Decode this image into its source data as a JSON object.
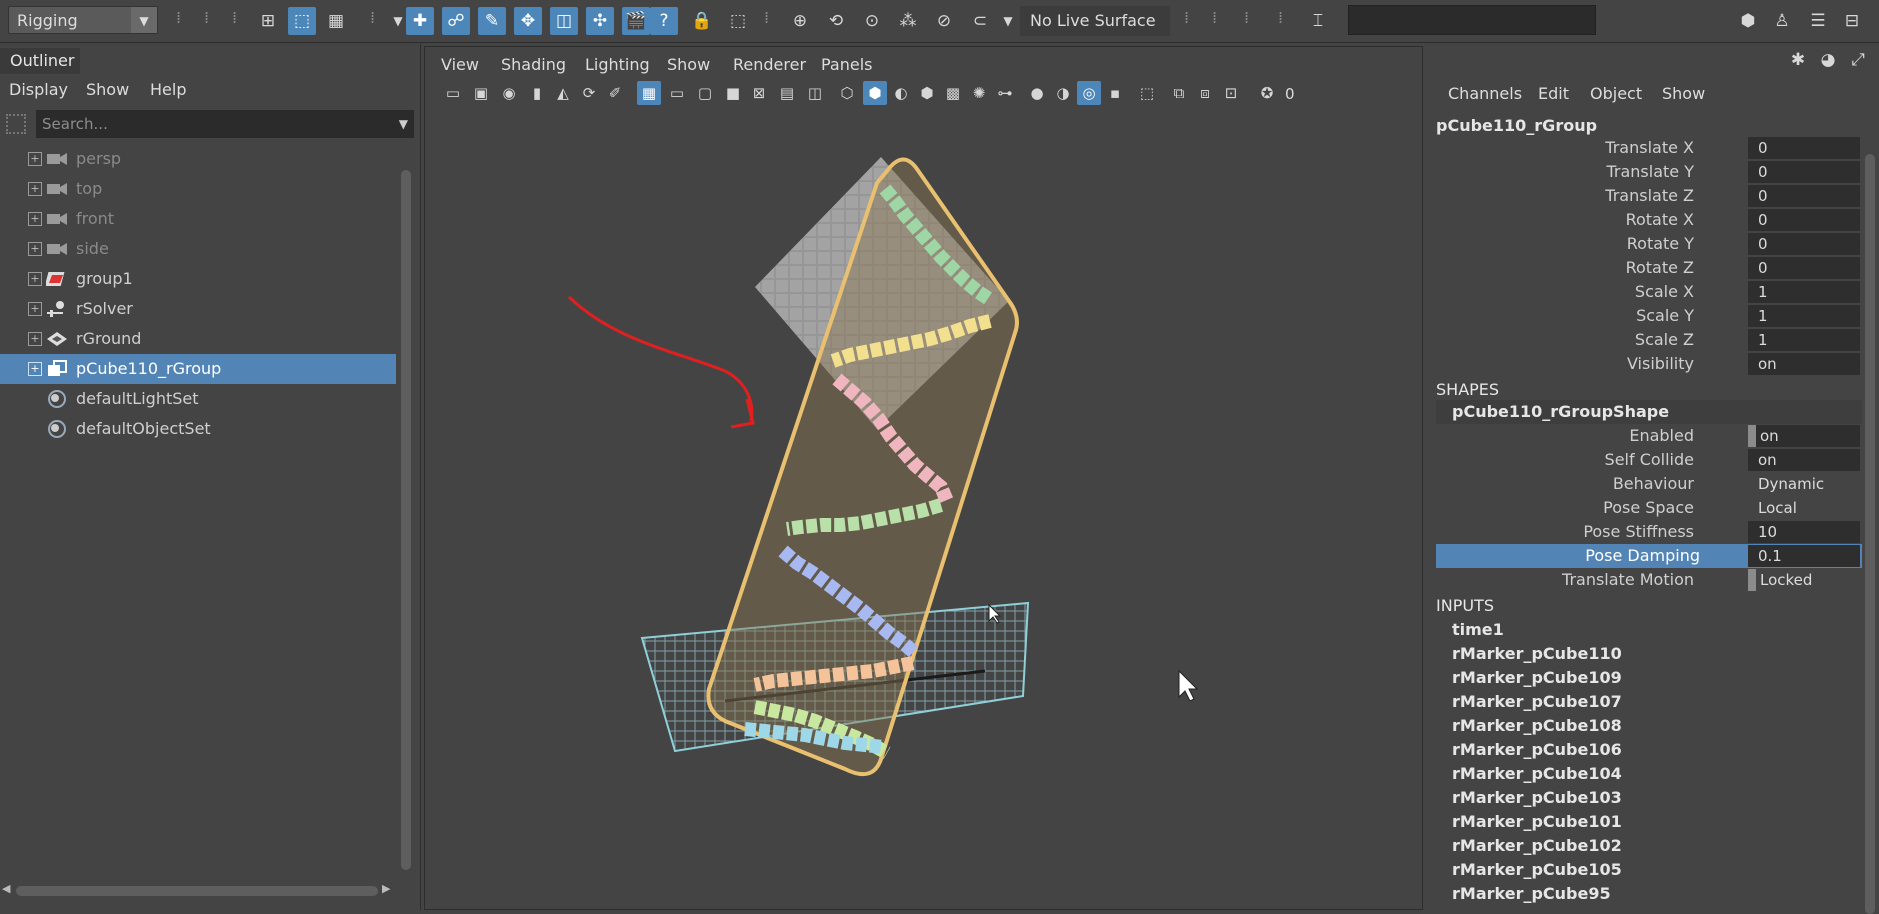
{
  "toolbar": {
    "mode": "Rigging",
    "live_surface": "No Live Surface",
    "icons": [
      "select-icon",
      "lasso-icon",
      "paint-select-icon",
      "move-icon",
      "rotate-icon",
      "scale-icon",
      "universal-manipulator-icon",
      "soft-modification-icon",
      "show-manipulator-icon",
      "clapper-icon",
      "help-icon",
      "lock-icon",
      "snap-grid-icon",
      "snap-curve-icon",
      "snap-point-icon",
      "snap-view-plane-icon",
      "snap-live-icon",
      "magnet-icon"
    ]
  },
  "outliner": {
    "tab": "Outliner",
    "menu": [
      "Display",
      "Show",
      "Help"
    ],
    "search_placeholder": "Search...",
    "items": [
      {
        "label": "persp",
        "icon": "camera-icon",
        "dim": true,
        "expandable": true
      },
      {
        "label": "top",
        "icon": "camera-icon",
        "dim": true,
        "expandable": true
      },
      {
        "label": "front",
        "icon": "camera-icon",
        "dim": true,
        "expandable": true
      },
      {
        "label": "side",
        "icon": "camera-icon",
        "dim": true,
        "expandable": true
      },
      {
        "label": "group1",
        "icon": "group-icon",
        "dim": false,
        "expandable": true
      },
      {
        "label": "rSolver",
        "icon": "solver-icon",
        "dim": false,
        "expandable": true
      },
      {
        "label": "rGround",
        "icon": "ground-icon",
        "dim": false,
        "expandable": true
      },
      {
        "label": "pCube110_rGroup",
        "icon": "rgroup-icon",
        "dim": false,
        "expandable": true,
        "selected": true
      },
      {
        "label": "defaultLightSet",
        "icon": "set-icon",
        "dim": false,
        "expandable": false
      },
      {
        "label": "defaultObjectSet",
        "icon": "set-icon",
        "dim": false,
        "expandable": false
      }
    ]
  },
  "viewport": {
    "menu": [
      "View",
      "Shading",
      "Lighting",
      "Show",
      "Renderer",
      "Panels"
    ],
    "counter": "0"
  },
  "channelbox": {
    "menu": [
      "Channels",
      "Edit",
      "Object",
      "Show"
    ],
    "node": "pCube110_rGroup",
    "attributes": [
      {
        "name": "Translate X",
        "value": "0"
      },
      {
        "name": "Translate Y",
        "value": "0"
      },
      {
        "name": "Translate Z",
        "value": "0"
      },
      {
        "name": "Rotate X",
        "value": "0"
      },
      {
        "name": "Rotate Y",
        "value": "0"
      },
      {
        "name": "Rotate Z",
        "value": "0"
      },
      {
        "name": "Scale X",
        "value": "1"
      },
      {
        "name": "Scale Y",
        "value": "1"
      },
      {
        "name": "Scale Z",
        "value": "1"
      },
      {
        "name": "Visibility",
        "value": "on"
      }
    ],
    "shapes_header": "SHAPES",
    "shape_node": "pCube110_rGroupShape",
    "shape_attributes": [
      {
        "name": "Enabled",
        "value": "on",
        "flag": true
      },
      {
        "name": "Self Collide",
        "value": "on"
      },
      {
        "name": "Behaviour",
        "value": "Dynamic"
      },
      {
        "name": "Pose Space",
        "value": "Local"
      },
      {
        "name": "Pose Stiffness",
        "value": "10"
      },
      {
        "name": "Pose Damping",
        "value": "0.1",
        "selected": true
      },
      {
        "name": "Translate Motion",
        "value": "Locked",
        "flag": true
      }
    ],
    "inputs_header": "INPUTS",
    "inputs": [
      "time1",
      "rMarker_pCube110",
      "rMarker_pCube109",
      "rMarker_pCube107",
      "rMarker_pCube108",
      "rMarker_pCube106",
      "rMarker_pCube104",
      "rMarker_pCube103",
      "rMarker_pCube101",
      "rMarker_pCube102",
      "rMarker_pCube105",
      "rMarker_pCube95"
    ]
  },
  "colors": {
    "selection": "#5285b6",
    "accent_blue": "#4d86b8",
    "group_outline": "#e8c070",
    "annotation_red": "#e02020"
  }
}
